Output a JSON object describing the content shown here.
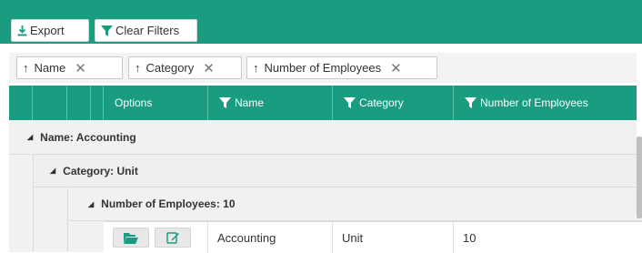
{
  "toolbar": {
    "export_label": "Export",
    "clear_filters_label": "Clear Filters"
  },
  "group_panel": {
    "chips": [
      {
        "label": "Name"
      },
      {
        "label": "Category"
      },
      {
        "label": "Number of Employees"
      }
    ]
  },
  "grid": {
    "columns": {
      "options": "Options",
      "name": "Name",
      "category": "Category",
      "employees": "Number of Employees"
    },
    "groups": {
      "level1": "Name: Accounting",
      "level2": "Category: Unit",
      "level3": "Number of Employees: 10"
    },
    "row": {
      "name": "Accounting",
      "category": "Unit",
      "employees": "10"
    }
  },
  "icons": {
    "export": "download-icon",
    "filter": "filter-icon",
    "folder": "folder-open-icon",
    "edit": "edit-icon",
    "sort": "sort-arrow-icon",
    "remove": "close-icon",
    "expand": "collapse-triangle-icon"
  },
  "colors": {
    "accent": "#1a9c80",
    "group_bg": "#f1f1f1"
  }
}
